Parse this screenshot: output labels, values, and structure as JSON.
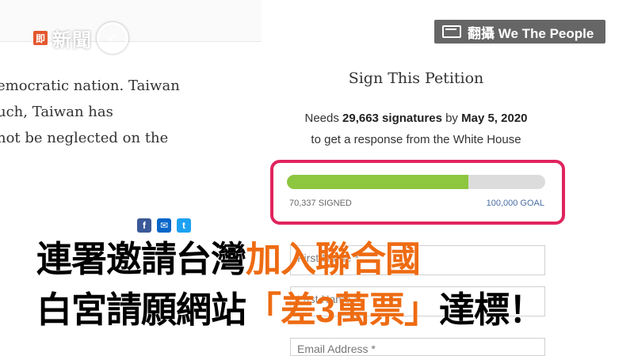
{
  "logo": {
    "badge": "即",
    "text": "新聞",
    "check": "✓"
  },
  "source_label": "翻攝 We The People",
  "article": {
    "lines": [
      "emocratic nation. Taiwan",
      "uch, Taiwan has",
      "not be neglected on the"
    ]
  },
  "petition": {
    "title": "Sign This Petition",
    "needs_prefix": "Needs",
    "signatures_needed": "29,663 signatures",
    "by_word": "by",
    "deadline": "May 5, 2020",
    "response_line": "to get a response from the White House",
    "signed_label": "70,337 SIGNED",
    "goal_label": "100,000 GOAL",
    "progress_fraction": 0.70337,
    "first_name_placeholder": "First Name *",
    "last_name_placeholder": "Last Name *",
    "email_placeholder": "Email Address *"
  },
  "share": {
    "facebook": "f",
    "email": "✉",
    "twitter": "t"
  },
  "headline": {
    "line1_black": "連署邀請台灣",
    "line1_orange": "加入聯合國",
    "line2_black1": "白宮請願網站",
    "line2_orange": "「差3萬票」",
    "line2_black2": "達標！"
  },
  "colors": {
    "accent_frame": "#e0245e",
    "progress": "#8dc63f",
    "headline_orange": "#ee6b12"
  }
}
